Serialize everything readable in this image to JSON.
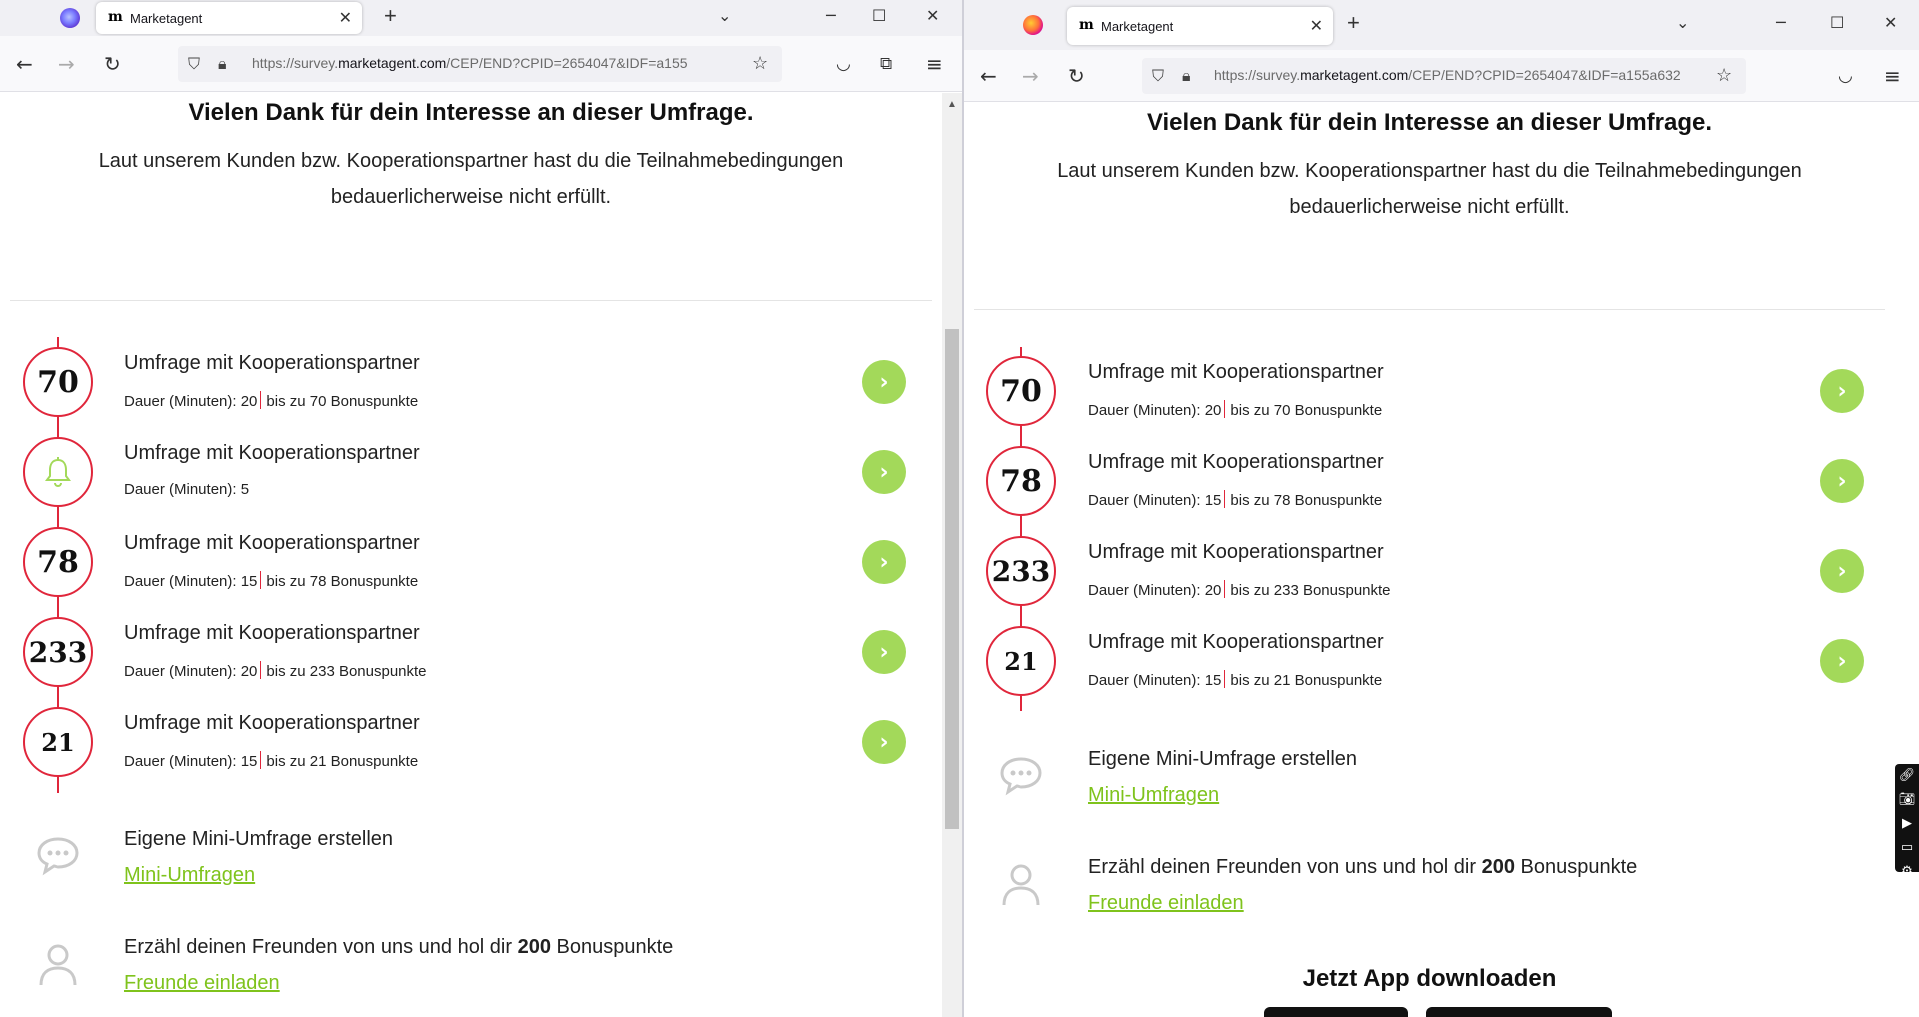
{
  "tab": {
    "title": "Marketagent",
    "favicon": "m",
    "close_glyph": "✕"
  },
  "nav": {
    "back_glyph": "←",
    "forward_glyph": "→",
    "reload_glyph": "↻",
    "url_prefix": "https://survey.",
    "url_domain": "marketagent.com",
    "url_rest_left": "/CEP/END?CPID=2654047&IDF=a155",
    "url_rest_right": "/CEP/END?CPID=2654047&IDF=a155a632",
    "newtab_glyph": "+"
  },
  "page": {
    "headline": "Vielen Dank für dein Interesse an dieser Umfrage.",
    "subline": "Laut unserem Kunden bzw. Kooperationspartner hast du die Teilnahmebedingungen bedauerlicherweise nicht erfüllt.",
    "survey_title": "Umfrage mit Kooperationspartner",
    "duration_label": "Dauer (Minuten):",
    "go_glyph": "›"
  },
  "left_surveys": [
    {
      "badge": "70",
      "minutes": "20",
      "bonus": "bis zu 70 Bonuspunkte"
    },
    {
      "badge": "",
      "minutes": "5",
      "bonus": ""
    },
    {
      "badge": "78",
      "minutes": "15",
      "bonus": "bis zu 78 Bonuspunkte"
    },
    {
      "badge": "233",
      "minutes": "20",
      "bonus": "bis zu 233 Bonuspunkte"
    },
    {
      "badge": "21",
      "minutes": "15",
      "bonus": "bis zu 21 Bonuspunkte"
    }
  ],
  "right_surveys": [
    {
      "badge": "70",
      "minutes": "20",
      "bonus": "bis zu 70 Bonuspunkte"
    },
    {
      "badge": "78",
      "minutes": "15",
      "bonus": "bis zu 78 Bonuspunkte"
    },
    {
      "badge": "233",
      "minutes": "20",
      "bonus": "bis zu 233 Bonuspunkte"
    },
    {
      "badge": "21",
      "minutes": "15",
      "bonus": "bis zu 21 Bonuspunkte"
    }
  ],
  "mini": {
    "title": "Eigene Mini-Umfrage erstellen",
    "link": "Mini-Umfragen"
  },
  "invite": {
    "title_pre": "Erzähl deinen Freunden von uns und hol dir ",
    "points": "200",
    "title_post": " Bonuspunkte",
    "link": "Freunde einladen"
  },
  "app": {
    "heading": "Jetzt App downloaden"
  },
  "colors": {
    "accent_red": "#e0263b",
    "accent_green": "#a3d95a",
    "link_green": "#7fc31c"
  },
  "icons": {
    "bell": "bell-icon",
    "chat": "chat-bubble-icon",
    "user": "user-icon"
  }
}
